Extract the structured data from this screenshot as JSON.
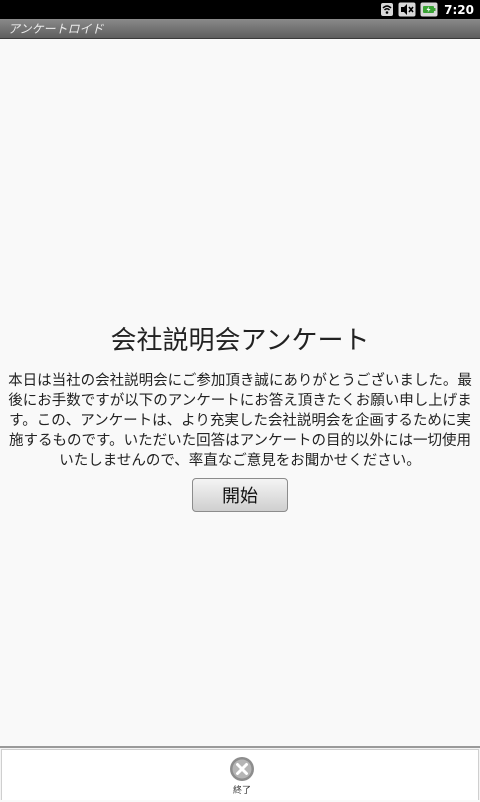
{
  "status_bar": {
    "time": "7:20",
    "icons": [
      "wifi-icon",
      "muted-speaker-icon",
      "battery-charging-icon"
    ]
  },
  "app": {
    "title": "アンケートロイド"
  },
  "main": {
    "survey_title": "会社説明会アンケート",
    "intro_text": "本日は当社の会社説明会にご参加頂き誠にありがとうございました。最後にお手数ですが以下のアンケートにお答え頂きたくお願い申し上げます。この、アンケートは、より充実した会社説明会を企画するために実施するものです。いただいた回答はアンケートの目的以外には一切使用いたしませんので、率直なご意見をお聞かせください。",
    "start_button_label": "開始"
  },
  "bottom_menu": {
    "exit_label": "終了",
    "exit_icon": "close-circle-icon"
  }
}
